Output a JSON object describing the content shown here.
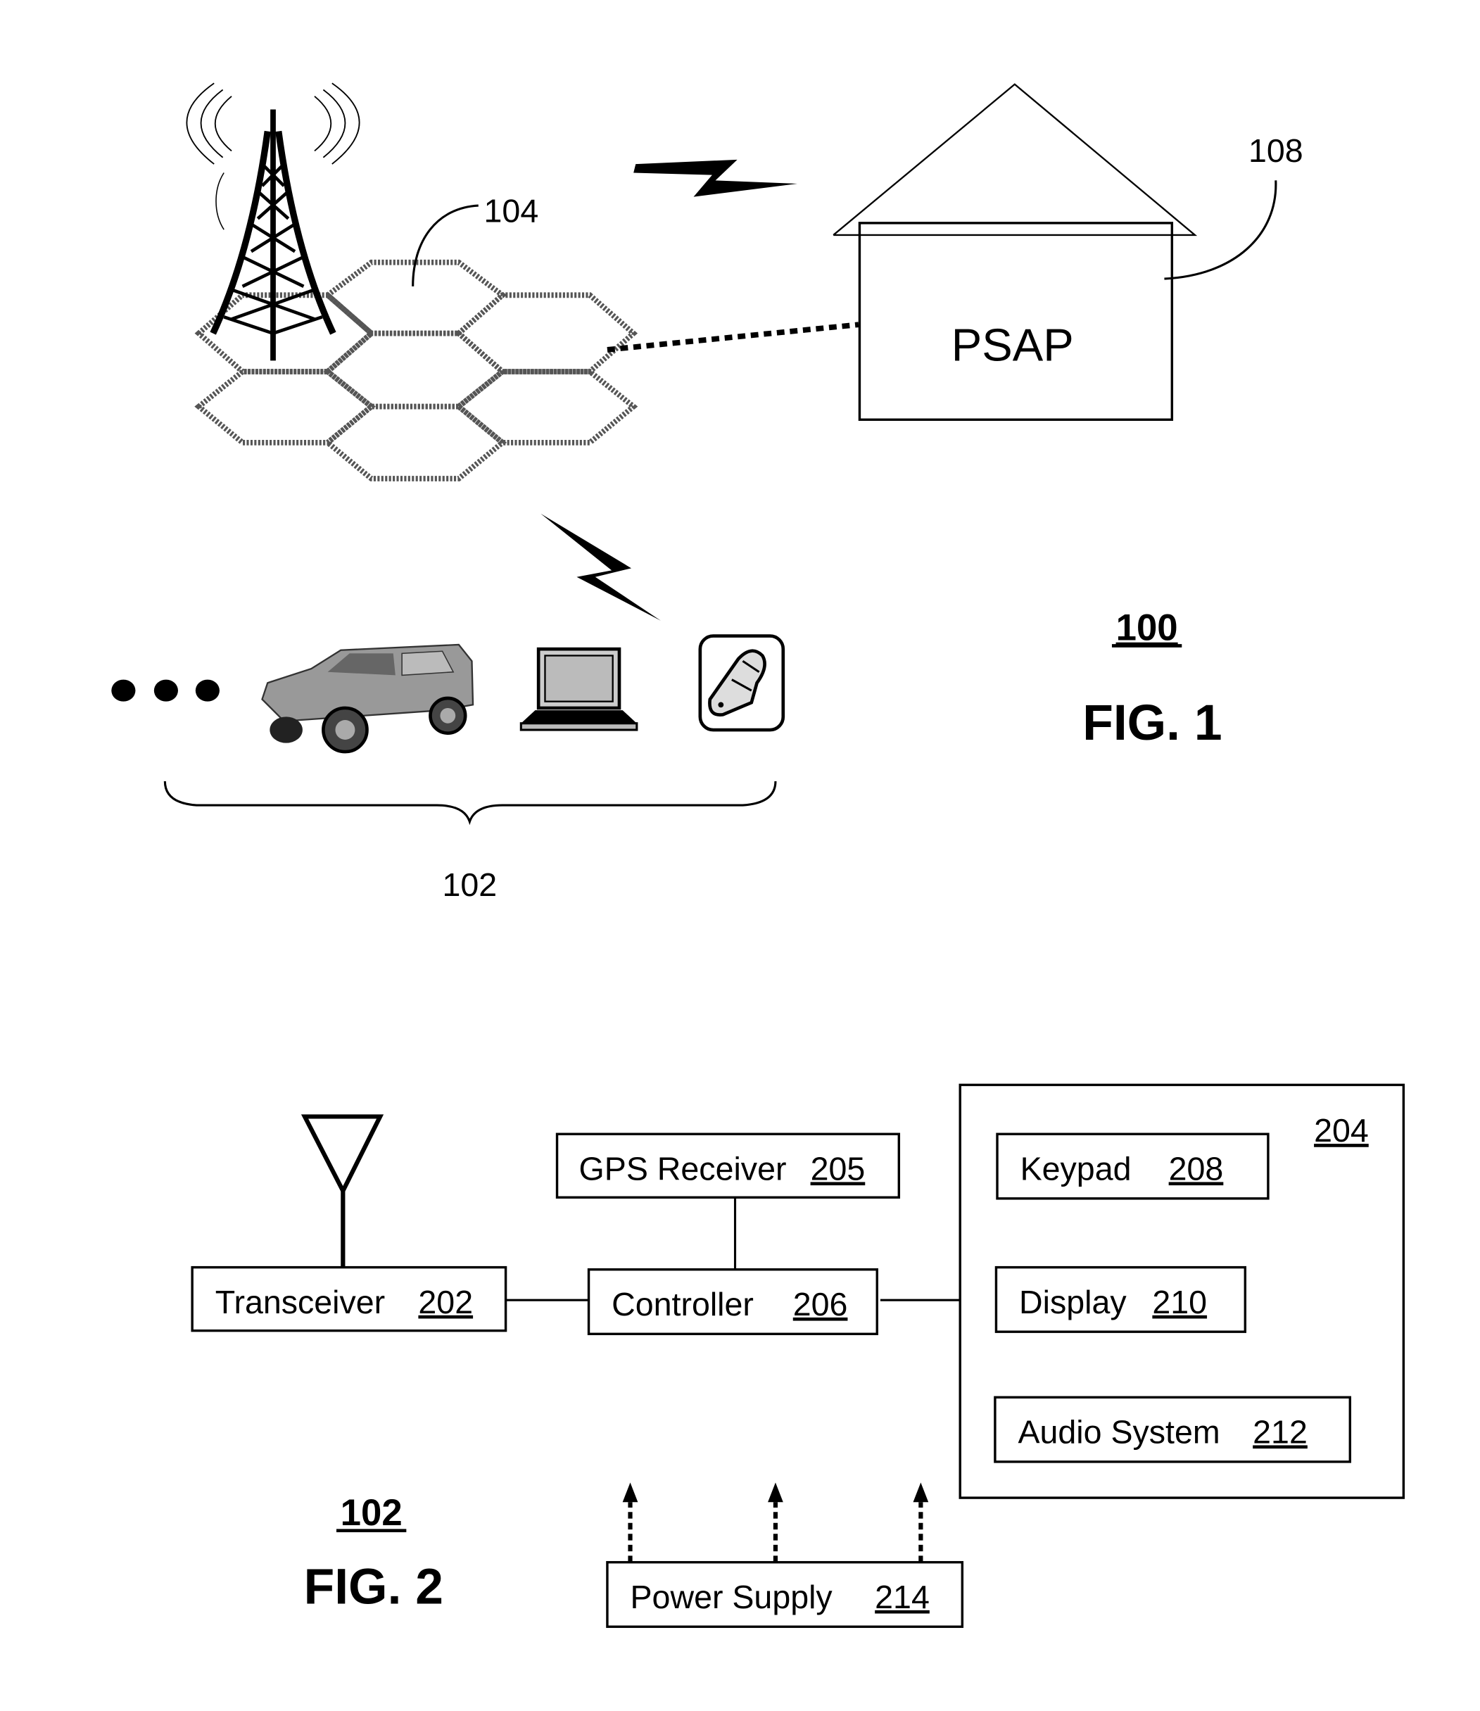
{
  "fig1": {
    "psap_label": "PSAP",
    "ref_network": "104",
    "ref_psap": "108",
    "ref_devices": "102",
    "ref_system": "100",
    "caption": "FIG. 1",
    "icons": [
      "cell-tower-icon",
      "lightning-icon",
      "house-icon",
      "car-icon",
      "laptop-icon",
      "mobile-phone-icon",
      "ellipsis-icon"
    ]
  },
  "fig2": {
    "ref_device": "102",
    "caption": "FIG. 2",
    "ref_ui_group": "204",
    "blocks": {
      "transceiver": {
        "name": "Transceiver",
        "ref": "202"
      },
      "gps": {
        "name": "GPS Receiver",
        "ref": "205"
      },
      "controller": {
        "name": "Controller",
        "ref": "206"
      },
      "keypad": {
        "name": "Keypad",
        "ref": "208"
      },
      "display": {
        "name": "Display",
        "ref": "210"
      },
      "audio": {
        "name": "Audio System",
        "ref": "212"
      },
      "power": {
        "name": "Power Supply",
        "ref": "214"
      }
    }
  }
}
